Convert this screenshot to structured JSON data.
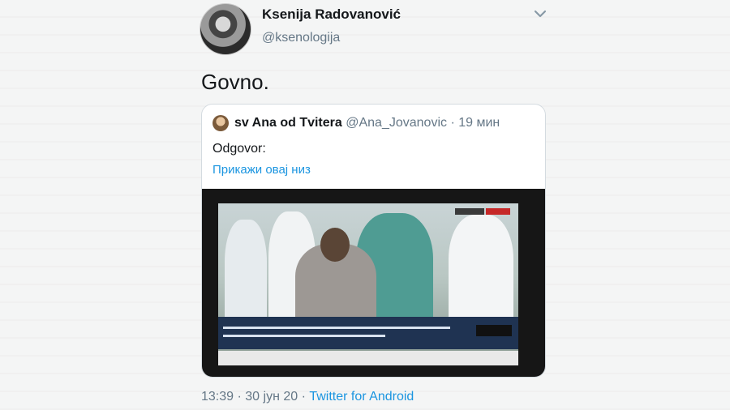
{
  "tweet": {
    "author": {
      "display_name": "Ksenija Radovanović",
      "handle": "@ksenologija"
    },
    "text": "Govno.",
    "menu_icon": "chevron-down-icon",
    "footer": {
      "time": "13:39",
      "sep1": " · ",
      "date": "30 јун 20",
      "sep2": " · ",
      "source": "Twitter for Android"
    }
  },
  "quoted_tweet": {
    "author": {
      "display_name": "sv Ana od Tvitera",
      "handle": "@Ana_Jovanovic"
    },
    "separator": " · ",
    "time_ago": "19 мин",
    "text": "Odgovor:",
    "show_thread_label": "Прикажи овај низ",
    "media": {
      "type": "video-screenshot",
      "description_icon": "tv-broadcast-image"
    }
  },
  "colors": {
    "accent": "#1b95e0",
    "text_primary": "#14171a",
    "text_secondary": "#657786",
    "border": "#d4dbe0"
  }
}
